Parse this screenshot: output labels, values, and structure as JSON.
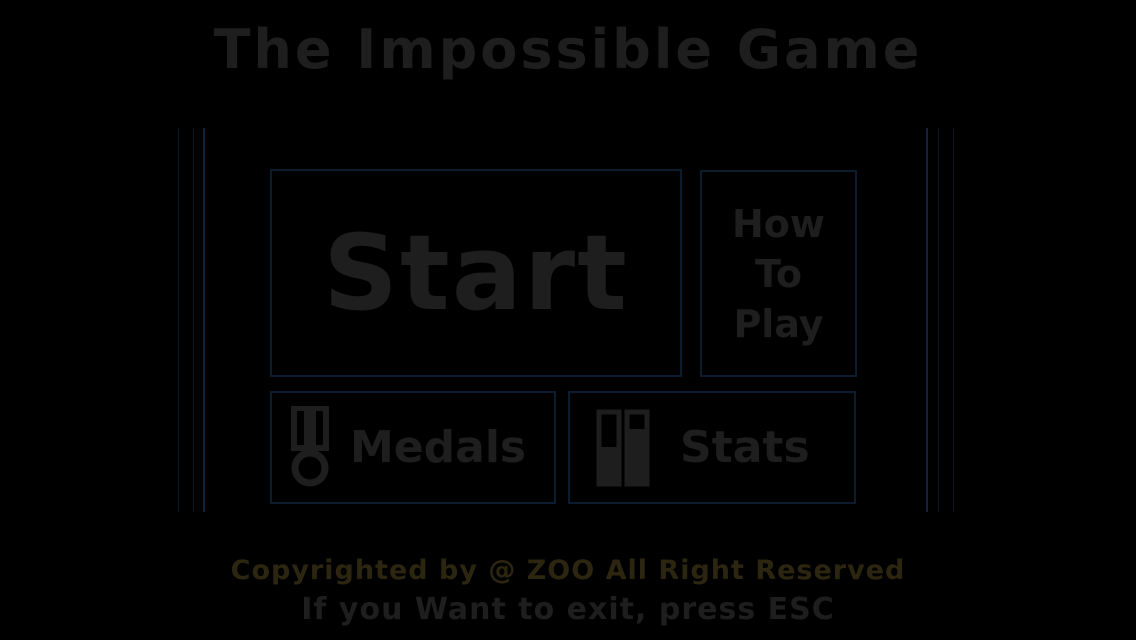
{
  "game": {
    "title": "The Impossible Game"
  },
  "menu": {
    "start_label": "Start",
    "how_to_play_lines": [
      "How",
      "To",
      "Play"
    ],
    "medals_label": "Medals",
    "stats_label": "Stats"
  },
  "icons": {
    "medals": "medal-icon",
    "stats": "stats-bars-icon"
  },
  "footer": {
    "copyright": "Copyrighted by @ ZOO All Right Reserved",
    "exit_hint": "If you Want to exit, press ESC"
  },
  "colors": {
    "background": "#000000",
    "text_dim": "#1e1e1e",
    "tile_border": "#0a1c2e",
    "copyright_text": "#2c2510"
  }
}
